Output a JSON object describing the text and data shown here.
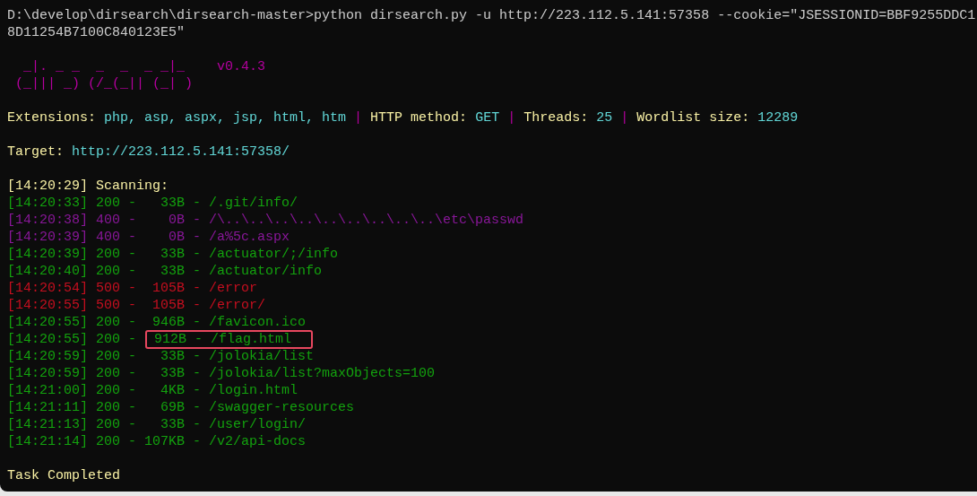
{
  "command_lines": [
    "D:\\develop\\dirsearch\\dirsearch-master>python dirsearch.py -u http://223.112.5.141:57358 --cookie=\"JSESSIONID=BBF9255DDC1",
    "8D11254B7100C840123E5\""
  ],
  "banner": {
    "art": [
      "  _|. _ _  _  _  _ _|_",
      "(_||| _) (/_(_|| (_| )"
    ],
    "version": "v0.4.3"
  },
  "info_separator": "|",
  "info": [
    {
      "label": "Extensions:",
      "value": "php, asp, aspx, jsp, html, htm"
    },
    {
      "label": "HTTP method:",
      "value": "GET"
    },
    {
      "label": "Threads:",
      "value": "25"
    },
    {
      "label": "Wordlist size:",
      "value": "12289"
    }
  ],
  "target": {
    "label": "Target:",
    "value": "http://223.112.5.141:57358/"
  },
  "scan_start": "[14:20:29] Scanning:",
  "row_separator": "-",
  "rows": [
    {
      "time": "[14:20:33]",
      "status": "200",
      "size": "33B",
      "path": "/.git/info/",
      "kind": "success",
      "highlighted": false
    },
    {
      "time": "[14:20:38]",
      "status": "400",
      "size": "0B",
      "path": "/\\..\\..\\..\\..\\..\\..\\..\\..\\..\\etc\\passwd",
      "kind": "client_error",
      "highlighted": false
    },
    {
      "time": "[14:20:39]",
      "status": "400",
      "size": "0B",
      "path": "/a%5c.aspx",
      "kind": "client_error",
      "highlighted": false
    },
    {
      "time": "[14:20:39]",
      "status": "200",
      "size": "33B",
      "path": "/actuator/;/info",
      "kind": "success",
      "highlighted": false
    },
    {
      "time": "[14:20:40]",
      "status": "200",
      "size": "33B",
      "path": "/actuator/info",
      "kind": "success",
      "highlighted": false
    },
    {
      "time": "[14:20:54]",
      "status": "500",
      "size": "105B",
      "path": "/error",
      "kind": "server_error",
      "highlighted": false
    },
    {
      "time": "[14:20:55]",
      "status": "500",
      "size": "105B",
      "path": "/error/",
      "kind": "server_error",
      "highlighted": false
    },
    {
      "time": "[14:20:55]",
      "status": "200",
      "size": "946B",
      "path": "/favicon.ico",
      "kind": "success",
      "highlighted": false
    },
    {
      "time": "[14:20:55]",
      "status": "200",
      "size": "912B",
      "path": "/flag.html",
      "kind": "success",
      "highlighted": true
    },
    {
      "time": "[14:20:59]",
      "status": "200",
      "size": "33B",
      "path": "/jolokia/list",
      "kind": "success",
      "highlighted": false
    },
    {
      "time": "[14:20:59]",
      "status": "200",
      "size": "33B",
      "path": "/jolokia/list?maxObjects=100",
      "kind": "success",
      "highlighted": false
    },
    {
      "time": "[14:21:00]",
      "status": "200",
      "size": "4KB",
      "path": "/login.html",
      "kind": "success",
      "highlighted": false
    },
    {
      "time": "[14:21:11]",
      "status": "200",
      "size": "69B",
      "path": "/swagger-resources",
      "kind": "success",
      "highlighted": false
    },
    {
      "time": "[14:21:13]",
      "status": "200",
      "size": "33B",
      "path": "/user/login/",
      "kind": "success",
      "highlighted": false
    },
    {
      "time": "[14:21:14]",
      "status": "200",
      "size": "107KB",
      "path": "/v2/api-docs",
      "kind": "success",
      "highlighted": false
    }
  ],
  "completion": "Task Completed"
}
